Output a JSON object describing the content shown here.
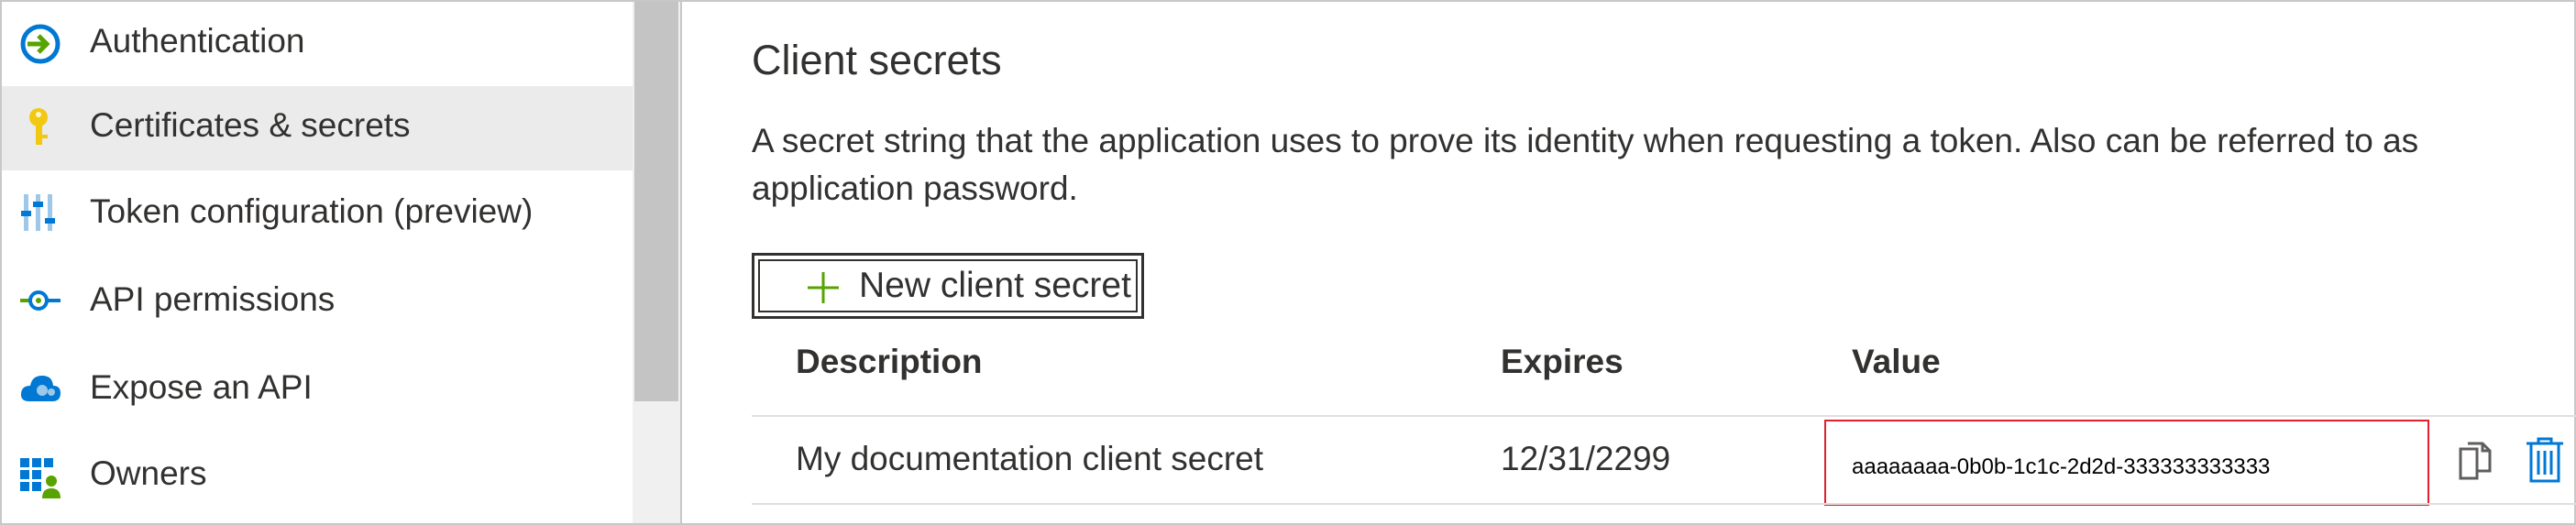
{
  "sidebar": {
    "items": [
      {
        "label": "Authentication",
        "icon": "authentication-icon"
      },
      {
        "label": "Certificates & secrets",
        "icon": "key-icon",
        "active": true
      },
      {
        "label": "Token configuration (preview)",
        "icon": "token-configuration-icon"
      },
      {
        "label": "API permissions",
        "icon": "api-permissions-icon"
      },
      {
        "label": "Expose an API",
        "icon": "cloud-api-icon"
      },
      {
        "label": "Owners",
        "icon": "owners-icon"
      }
    ]
  },
  "main": {
    "title": "Client secrets",
    "description": "A secret string that the application uses to prove its identity when requesting a token. Also can be referred to as application password.",
    "new_button_label": "New client secret",
    "table": {
      "columns": [
        "Description",
        "Expires",
        "Value"
      ],
      "rows": [
        {
          "description": "My documentation client secret",
          "expires": "12/31/2299",
          "value": "aaaaaaaa-0b0b-1c1c-2d2d-333333333333"
        }
      ]
    }
  },
  "colors": {
    "accent_blue": "#0078d4",
    "highlight_red": "#e0202e",
    "active_item_bg": "#ebebeb",
    "key_yellow": "#f2c811",
    "plus_green": "#57a300"
  }
}
